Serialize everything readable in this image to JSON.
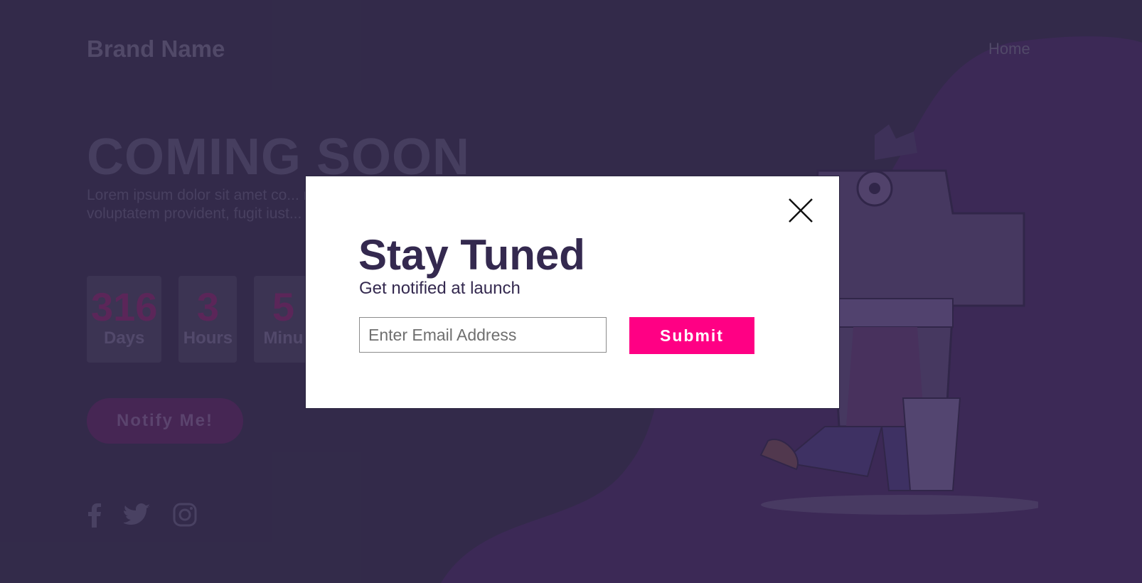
{
  "header": {
    "brand": "Brand Name",
    "nav_home": "Home"
  },
  "hero": {
    "title": "COMING SOON",
    "description": "Lorem ipsum dolor sit amet co... maxime asperiores tempora ad... voluptatem provident, fugit iust... laborum! Quibusdam!"
  },
  "countdown": [
    {
      "value": "316",
      "label": "Days"
    },
    {
      "value": "3",
      "label": "Hours"
    },
    {
      "value": "5",
      "label": "Minu"
    }
  ],
  "notify_button": "Notify Me!",
  "social": [
    "facebook-icon",
    "twitter-icon",
    "instagram-icon"
  ],
  "modal": {
    "title": "Stay Tuned",
    "subtitle": "Get notified at launch",
    "email_placeholder": "Enter Email Address",
    "submit_label": "Submit"
  },
  "colors": {
    "accent": "#ff0084",
    "dark": "#34294f",
    "background": "#3c3553"
  }
}
